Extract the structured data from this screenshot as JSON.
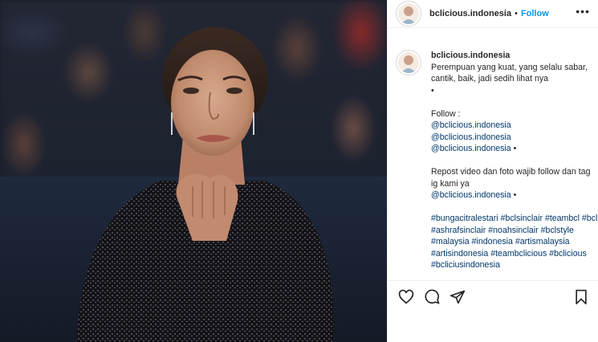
{
  "post": {
    "username": "bclicious.indonesia",
    "separator": "•",
    "follow_label": "Follow",
    "more_label": "•••"
  },
  "caption": {
    "username": "bclicious.indonesia",
    "text1": "Perempuan yang kuat, yang selalu sabar, cantik, baik, jadi sedih lihat nya",
    "bullet1": "•",
    "follow_intro": "Follow :",
    "mention1": "@bclicious.indonesia",
    "mention2": "@bclicious.indonesia",
    "mention3": "@bclicious.indonesia",
    "bullet3": " •",
    "repost": "Repost video dan foto wajib follow dan tag ig kami ya",
    "mention4": "@bclicious.indonesia",
    "bullet4": " •",
    "hashtags": [
      "#bungacitralestari",
      "#bclsinclair",
      "#teambcl",
      "#bcl",
      "#ashrafsinclair",
      "#noahsinclair",
      "#bclstyle",
      "#malaysia",
      "#indonesia",
      "#artismalaysia",
      "#artisindonesia",
      "#teambclicious",
      "#bclicious",
      "#bcliciusindonesia"
    ]
  },
  "icons": {
    "like": "heart-icon",
    "comment": "comment-icon",
    "share": "share-icon",
    "save": "bookmark-icon",
    "more": "more-options-icon"
  },
  "colors": {
    "link": "#00376b",
    "follow": "#0095f6",
    "text": "#262626",
    "border": "#efefef"
  }
}
